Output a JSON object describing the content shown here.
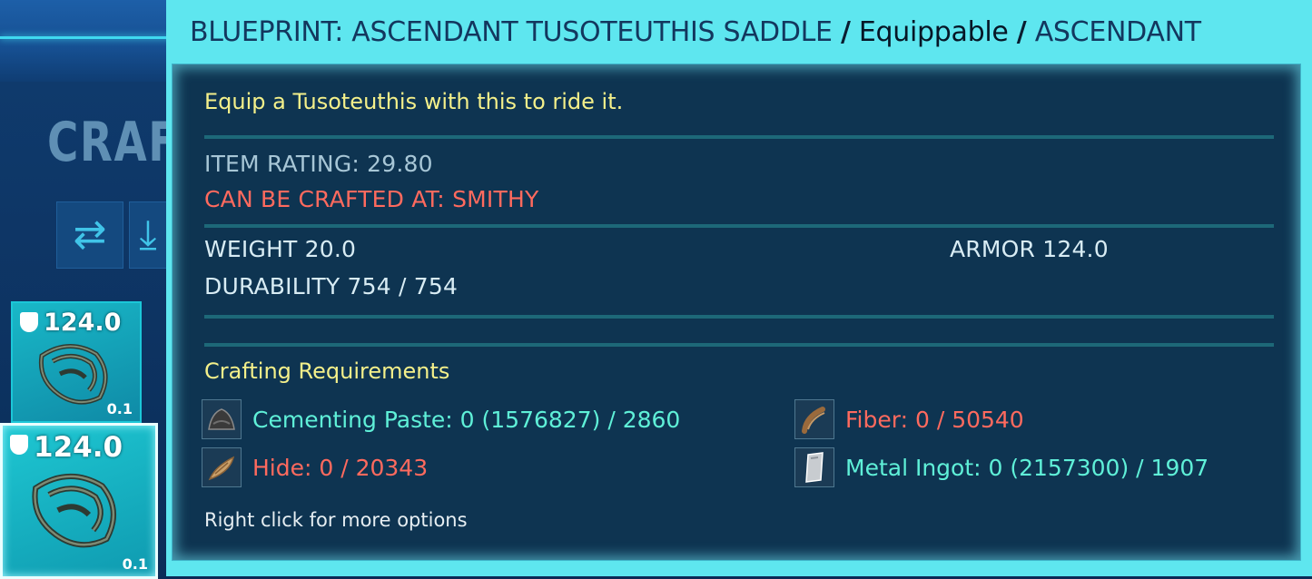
{
  "background": {
    "panel_title": "CRAFT",
    "slots": [
      {
        "armor": "124.0",
        "weight": "0.1"
      },
      {
        "armor": "124.0",
        "weight": "0.1"
      }
    ]
  },
  "tooltip": {
    "name": "BLUEPRINT: ASCENDANT TUSOTEUTHIS SADDLE",
    "separator": "/",
    "type": "Equippable",
    "quality": "ASCENDANT",
    "description": "Equip a Tusoteuthis with this to ride it.",
    "item_rating": "ITEM RATING: 29.80",
    "crafted_at": "CAN BE CRAFTED AT: SMITHY",
    "weight": "WEIGHT 20.0",
    "armor": "ARMOR 124.0",
    "durability": "DURABILITY 754 / 754",
    "requirements_title": "Crafting Requirements",
    "requirements": [
      {
        "text": "Cementing Paste: 0 (1576827) / 2860",
        "icon": "cementing-paste-icon"
      },
      {
        "text": "Fiber: 0 / 50540",
        "icon": "fiber-icon"
      },
      {
        "text": "Hide: 0 / 20343",
        "icon": "hide-icon"
      },
      {
        "text": "Metal Ingot: 0 (2157300) / 1907",
        "icon": "metal-ingot-icon"
      }
    ],
    "hint": "Right click for more options"
  },
  "colors": {
    "header_bg": "#5ee6ef",
    "body_bg": "#0a2a48",
    "yellow_text": "#f4f08a",
    "red_text": "#ff6a5e",
    "green_text": "#5ff0d8"
  }
}
